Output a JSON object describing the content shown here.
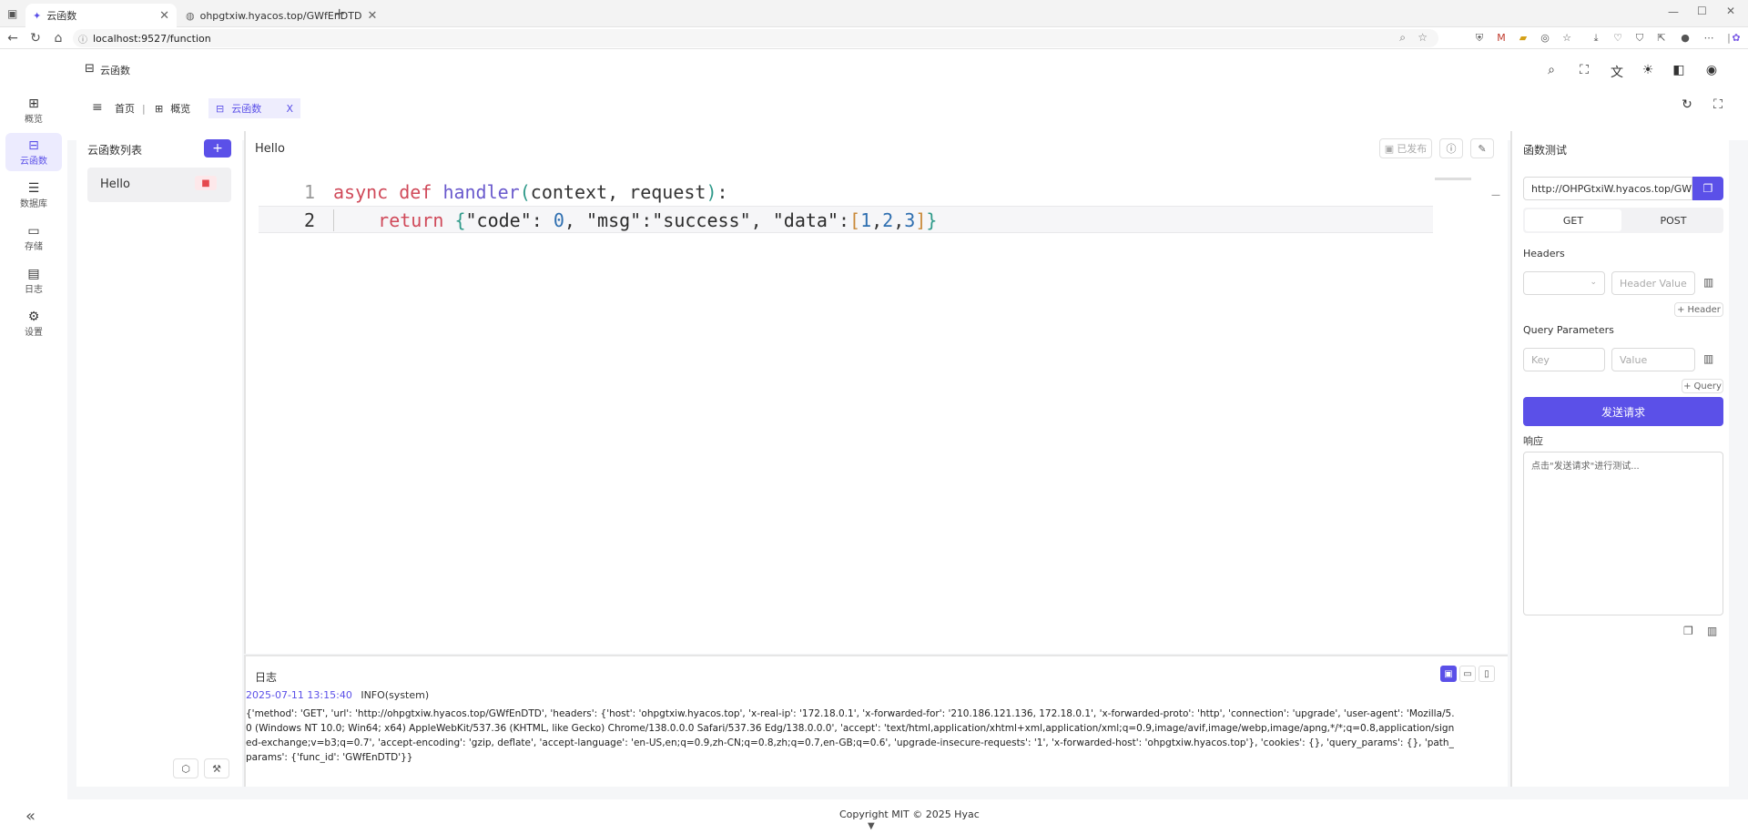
{
  "browser": {
    "tabs": [
      {
        "label": "云函数",
        "active": true
      },
      {
        "label": "ohpgtxiw.hyacos.top/GWfEnDTD",
        "active": false
      }
    ],
    "address": "localhost:9527/function"
  },
  "app": {
    "page_title": "云函数",
    "sidebar": [
      {
        "label": "概览",
        "icon": "grid-icon"
      },
      {
        "label": "云函数",
        "icon": "function-box-icon",
        "active": true
      },
      {
        "label": "数据库",
        "icon": "database-icon"
      },
      {
        "label": "存储",
        "icon": "storage-icon"
      },
      {
        "label": "日志",
        "icon": "log-clipboard-icon"
      },
      {
        "label": "设置",
        "icon": "gear-icon"
      }
    ],
    "tabs": [
      {
        "label": "首页"
      },
      {
        "label": "概览"
      },
      {
        "label": "云函数",
        "active": true,
        "close": "X"
      }
    ],
    "footer": "Copyright MIT © 2025 Hyac"
  },
  "function_list": {
    "title": "云函数列表",
    "add_label": "+",
    "items": [
      {
        "name": "Hello"
      }
    ]
  },
  "editor": {
    "function_name": "Hello",
    "publish_label": "已发布",
    "lines": [
      {
        "num": "1"
      },
      {
        "num": "2"
      }
    ]
  },
  "log": {
    "title": "日志",
    "entries": [
      {
        "timestamp": "2025-07-11 13:15:40",
        "level": "INFO(system)",
        "message": "{'method': 'GET', 'url': 'http://ohpgtxiw.hyacos.top/GWfEnDTD', 'headers': {'host': 'ohpgtxiw.hyacos.top', 'x-real-ip': '172.18.0.1', 'x-forwarded-for': '210.186.121.136, 172.18.0.1', 'x-forwarded-proto': 'http', 'connection': 'upgrade', 'user-agent': 'Mozilla/5.0 (Windows NT 10.0; Win64; x64) AppleWebKit/537.36 (KHTML, like Gecko) Chrome/138.0.0.0 Safari/537.36 Edg/138.0.0.0', 'accept': 'text/html,application/xhtml+xml,application/xml;q=0.9,image/avif,image/webp,image/apng,*/*;q=0.8,application/signed-exchange;v=b3;q=0.7', 'accept-encoding': 'gzip, deflate', 'accept-language': 'en-US,en;q=0.9,zh-CN;q=0.8,zh;q=0.7,en-GB;q=0.6', 'upgrade-insecure-requests': '1', 'x-forwarded-host': 'ohpgtxiw.hyacos.top'}, 'cookies': {}, 'query_params': {}, 'path_params': {'func_id': 'GWfEnDTD'}}"
      }
    ]
  },
  "tester": {
    "title": "函数测试",
    "url": "http://OHPGtxiW.hyacos.top/GW",
    "methods": [
      "GET",
      "POST"
    ],
    "selected_method": "GET",
    "headers_label": "Headers",
    "header_value_placeholder": "Header Value",
    "add_header_label": "Header",
    "query_label": "Query Parameters",
    "key_placeholder": "Key",
    "value_placeholder": "Value",
    "add_query_label": "Query",
    "send_label": "发送请求",
    "response_label": "响应",
    "response_placeholder": "点击\"发送请求\"进行测试..."
  },
  "colors": {
    "accent": "#5b50e8",
    "danger_bg": "#fde8ea",
    "danger": "#e5484d"
  }
}
